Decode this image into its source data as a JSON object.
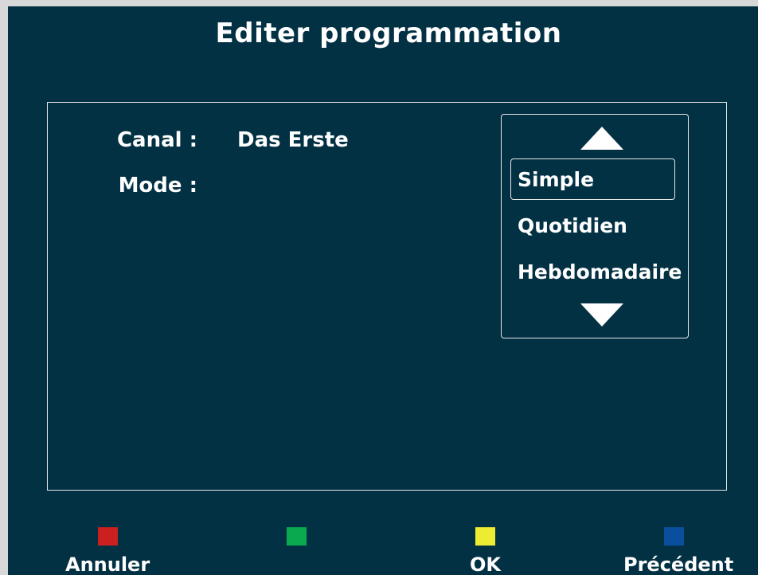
{
  "title": "Editer programmation",
  "fields": {
    "canal_label": "Canal :",
    "canal_value": "Das Erste",
    "mode_label": "Mode :"
  },
  "mode_options": [
    "Simple",
    "Quotidien",
    "Hebdomadaire"
  ],
  "selected_option": "Simple",
  "color_keys": {
    "red": {
      "color": "#cc1f1f",
      "label": "Annuler"
    },
    "green": {
      "color": "#0aa84f",
      "label": ""
    },
    "yellow": {
      "color": "#ecec32",
      "label": "OK"
    },
    "blue": {
      "color": "#0a4f9e",
      "label": "Précédent"
    }
  },
  "colors": {
    "background": "#033144",
    "text": "#ffffff",
    "border": "#e6e6e6"
  }
}
